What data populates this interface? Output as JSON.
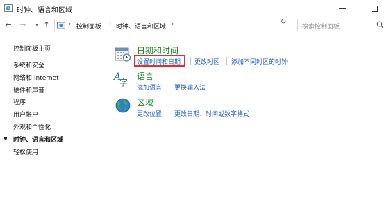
{
  "window": {
    "title": "时钟、语言和区域"
  },
  "address": {
    "crumbs": [
      "控制面板",
      "时钟、语言和区域"
    ],
    "search_placeholder": "搜索控制面板"
  },
  "sidebar": {
    "home": "控制面板主页",
    "items": [
      {
        "label": "系统和安全",
        "current": false
      },
      {
        "label": "网络和 Internet",
        "current": false
      },
      {
        "label": "硬件和声音",
        "current": false
      },
      {
        "label": "程序",
        "current": false
      },
      {
        "label": "用户帐户",
        "current": false
      },
      {
        "label": "外观和个性化",
        "current": false
      },
      {
        "label": "时钟、语言和区域",
        "current": true
      },
      {
        "label": "轻松使用",
        "current": false
      }
    ]
  },
  "categories": [
    {
      "title": "日期和时间",
      "icon": "calendar-clock-icon",
      "links": [
        "设置时间和日期",
        "更改时区",
        "添加不同时区的时钟"
      ],
      "highlighted_link": "设置时间和日期"
    },
    {
      "title": "语言",
      "icon": "language-icon",
      "links": [
        "添加语言",
        "更换输入法"
      ]
    },
    {
      "title": "区域",
      "icon": "globe-icon",
      "links": [
        "更改位置",
        "更改日期、时间或数字格式"
      ]
    }
  ],
  "colors": {
    "category_title": "#1a8a1a",
    "link": "#1f5fbf",
    "highlight_border": "#e0302a"
  }
}
